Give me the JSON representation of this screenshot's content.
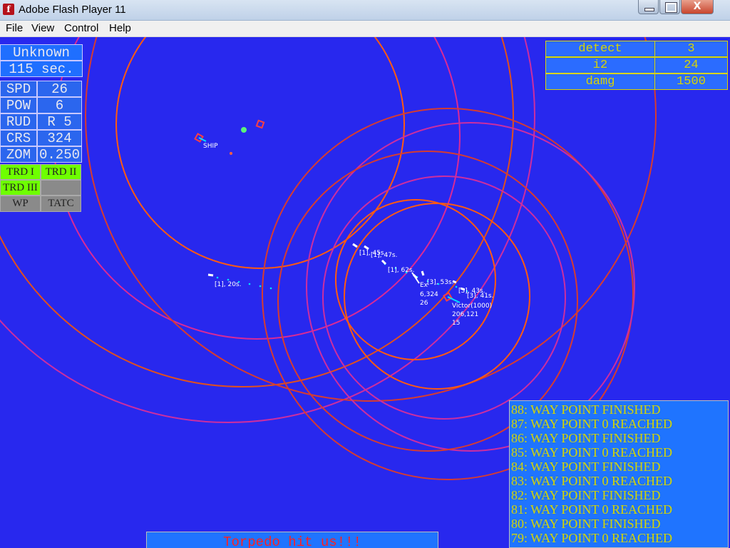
{
  "window": {
    "title": "Adobe Flash Player 11",
    "icon": "flash-app-icon",
    "close_glyph": "X"
  },
  "menu": [
    "File",
    "View",
    "Control",
    "Help"
  ],
  "status_panel": {
    "target": "Unknown",
    "time": "115 sec.",
    "stats": [
      {
        "label": "SPD",
        "value": "26"
      },
      {
        "label": "POW",
        "value": "6"
      },
      {
        "label": "RUD",
        "value": "R 5"
      },
      {
        "label": "CRS",
        "value": "324"
      },
      {
        "label": "ZOM",
        "value": "0.250"
      }
    ],
    "buttons": [
      "TRD I",
      "TRD II",
      "TRD III",
      "WP",
      "TATC"
    ]
  },
  "detect_table": [
    {
      "label": "detect",
      "value": "3"
    },
    {
      "label": "i2",
      "value": "24"
    },
    {
      "label": "damg",
      "value": "1500"
    }
  ],
  "map_labels": {
    "ship": "SHIP",
    "t1": "[1], 20s.",
    "t2": "[1], 45s.",
    "t3": "[1], 47s.",
    "t4": "[1], 62s.",
    "t5": "[3], 53s.",
    "t6": "[3], 43s.",
    "t7": "[3], 41s.",
    "own_name": "Ex",
    "own_line1": "6,324",
    "own_line2": "26",
    "victor_name": "Victor(1000)",
    "victor_line1": "206,121",
    "victor_line2": "15"
  },
  "messages": [
    "88: WAY POINT FINISHED",
    "87: WAY POINT 0 REACHED",
    "86: WAY POINT FINISHED",
    "85: WAY POINT 0 REACHED",
    "84: WAY POINT FINISHED",
    "83: WAY POINT 0 REACHED",
    "82: WAY POINT FINISHED",
    "81: WAY POINT 0 REACHED",
    "80: WAY POINT FINISHED",
    "79: WAY POINT 0 REACHED"
  ],
  "alert": "Torpedo hit us!!!",
  "colors": {
    "sea": "#2828ee",
    "panel": "#1f6fff",
    "text_yellow": "#d4d400",
    "alert_red": "#ff2020",
    "active_green": "#6eff00",
    "inactive_gray": "#8a8a8a"
  }
}
